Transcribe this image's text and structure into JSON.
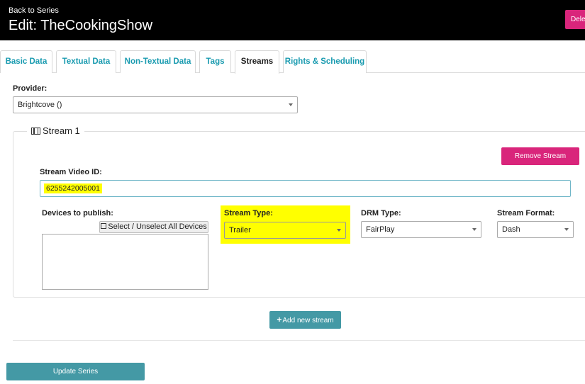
{
  "header": {
    "back_label": "Back to Series",
    "title": "Edit: TheCookingShow",
    "delete_label": "Dele"
  },
  "tabs": [
    {
      "label": "Basic Data"
    },
    {
      "label": "Textual Data"
    },
    {
      "label": "Non-Textual Data"
    },
    {
      "label": "Tags"
    },
    {
      "label": "Streams"
    },
    {
      "label": "Rights & Scheduling"
    }
  ],
  "provider": {
    "label": "Provider:",
    "value": "Brightcove ()"
  },
  "stream": {
    "legend": "Stream 1",
    "remove_label": "Remove Stream",
    "video_id_label": "Stream Video ID:",
    "video_id_value": "6255242005001",
    "devices_label": "Devices to publish:",
    "select_all_label": "Select / Unselect All Devices",
    "stream_type_label": "Stream Type:",
    "stream_type_value": "Trailer",
    "drm_label": "DRM Type:",
    "drm_value": "FairPlay",
    "format_label": "Stream Format:",
    "format_value": "Dash"
  },
  "actions": {
    "add_stream_label": "Add new stream",
    "update_label": "Update Series"
  },
  "colors": {
    "accent_pink": "#d9257b",
    "accent_teal": "#4499a5",
    "tab_text": "#1a9bb0",
    "highlight": "#ffff00"
  }
}
